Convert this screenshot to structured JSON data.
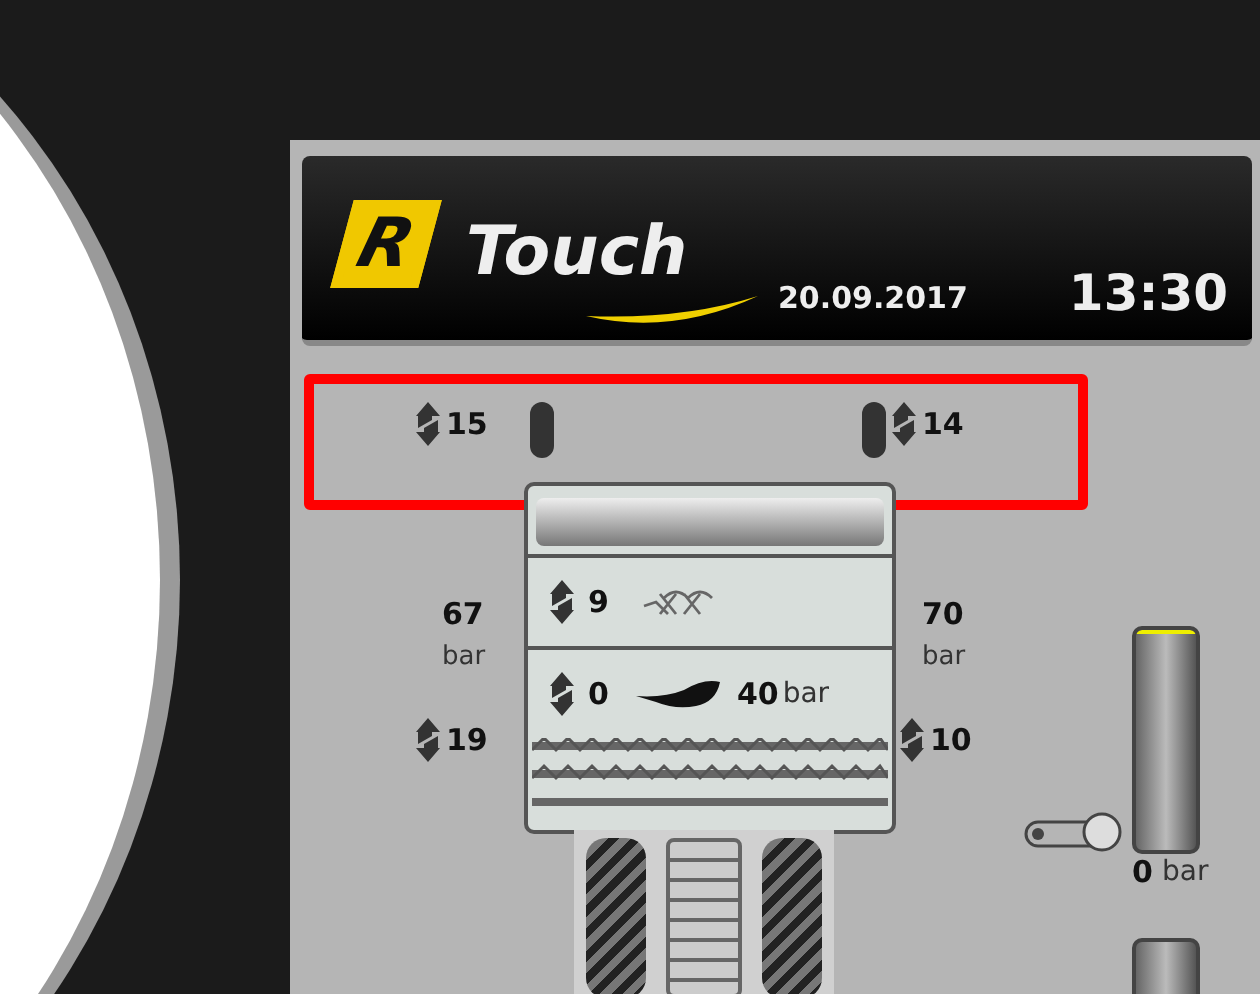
{
  "header": {
    "logo_letter": "R",
    "logo_text": "Touch",
    "date": "20.09.2017",
    "time": "13:30"
  },
  "wing_sections": [
    {
      "value": "15"
    },
    {
      "value": "14"
    }
  ],
  "pressures": [
    {
      "value": "67",
      "unit": "bar"
    },
    {
      "value": "70",
      "unit": "bar"
    }
  ],
  "side_sections": [
    {
      "value": "19"
    },
    {
      "value": "10"
    }
  ],
  "center": {
    "top_value": "9",
    "mid_value": "0",
    "mid_pressure": "40",
    "mid_unit": "bar"
  },
  "gauge": {
    "value": "0",
    "unit": "bar"
  }
}
